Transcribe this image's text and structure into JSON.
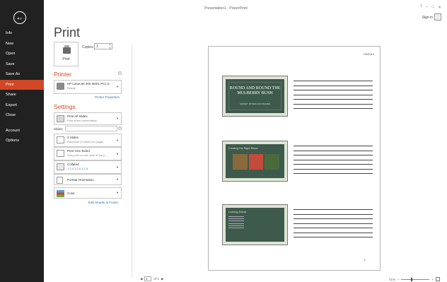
{
  "window": {
    "title": "Presentation1 - PowerPoint",
    "controls": [
      "?",
      "–",
      "□",
      "✕"
    ],
    "sign_in": "Sign in"
  },
  "sidebar": {
    "back_icon": "back-arrow-icon",
    "items": [
      {
        "label": "Info"
      },
      {
        "label": "New"
      },
      {
        "label": "Open"
      },
      {
        "label": "Save"
      },
      {
        "label": "Save As"
      },
      {
        "label": "Print",
        "active": true
      },
      {
        "label": "Share"
      },
      {
        "label": "Export"
      },
      {
        "label": "Close"
      },
      {
        "label": "Account"
      },
      {
        "label": "Options"
      }
    ],
    "bg_color": "#212121",
    "active_color": "#d24726"
  },
  "print": {
    "heading": "Print",
    "button_label": "Print",
    "copies_label": "Copies:",
    "copies_value": "1"
  },
  "printer": {
    "heading": "Printer",
    "name": "HP LaserJet 400 M401 PCL 6",
    "status": "Ready",
    "properties_link": "Printer Properties"
  },
  "settings": {
    "heading": "Settings",
    "slides_label": "Slides:",
    "options": [
      {
        "title": "Print All Slides",
        "subtitle": "Print entire presentation",
        "icon": "slides-icon"
      },
      {
        "title": "3 Slides",
        "subtitle": "Handouts (3 slides per page)",
        "icon": "handout-icon"
      },
      {
        "title": "Print One Sided",
        "subtitle": "Only print on one side of the p...",
        "icon": "one-sided-icon"
      },
      {
        "title": "Collated",
        "subtitle": "1,2,3    1,2,3    1,2,3",
        "icon": "collated-icon"
      },
      {
        "title": "Portrait Orientation",
        "subtitle": "",
        "icon": "portrait-icon"
      },
      {
        "title": "Color",
        "subtitle": "",
        "icon": "color-icon"
      }
    ],
    "edit_header_footer": "Edit Header & Footer"
  },
  "preview": {
    "date": "7/9/2014",
    "page_number": "1",
    "slide1": {
      "title": "ROUND AND ROUND THE MULBERRY BUSH",
      "subtitle": "NURSERY RHYMES FOR CHILDREN"
    },
    "slide2": {
      "title": "Creating the Right Blend"
    },
    "slide3": {
      "title": "Looking Ahead"
    }
  },
  "footer": {
    "page_current": "1",
    "page_total_label": "of 1",
    "zoom_label": "71%"
  }
}
